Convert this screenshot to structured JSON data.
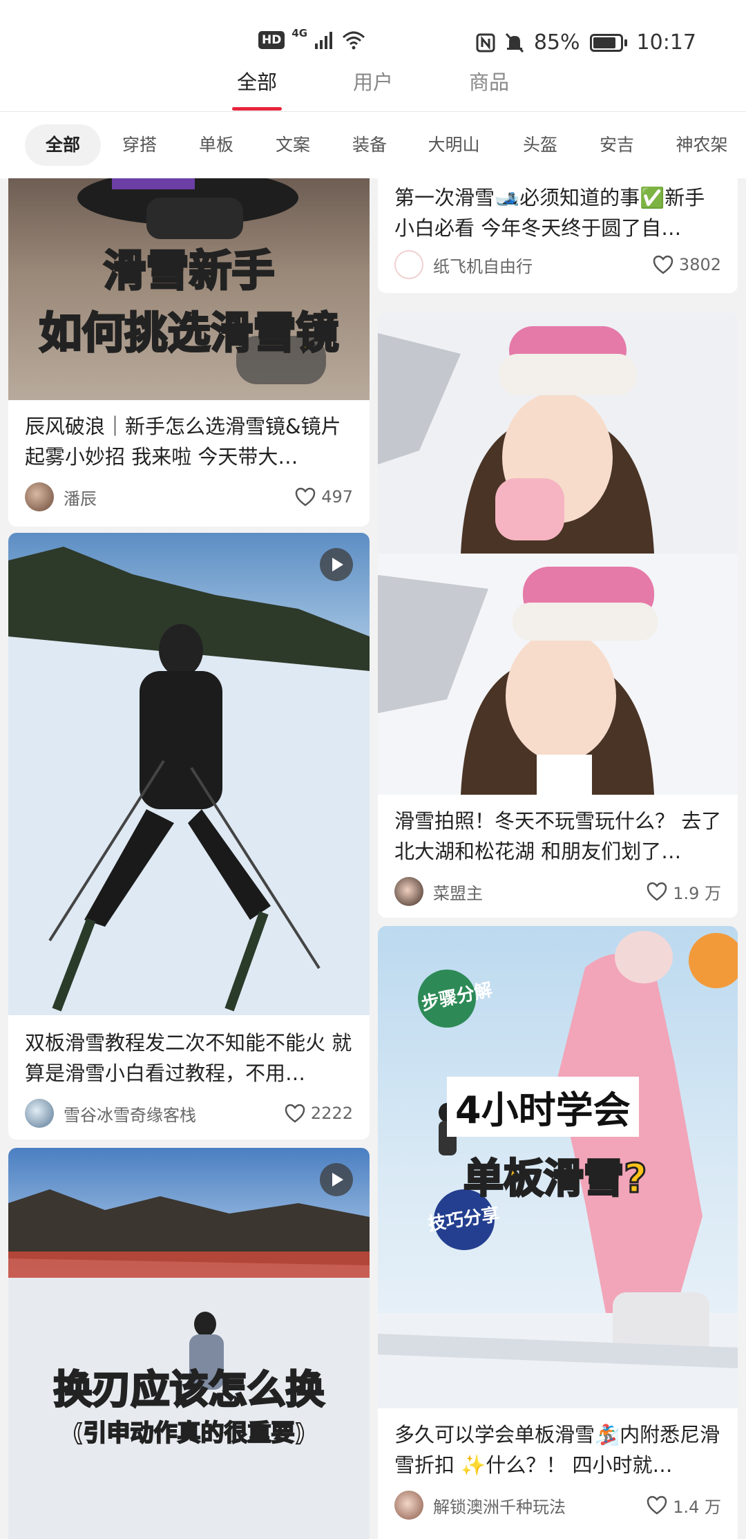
{
  "status": {
    "hd": "HD",
    "net": "4G",
    "battery": "85%",
    "battery_level": 0.85,
    "time": "10:17"
  },
  "top_tabs": [
    "全部",
    "用户",
    "商品"
  ],
  "chips": [
    "全部",
    "穿搭",
    "单板",
    "文案",
    "装备",
    "大明山",
    "头盔",
    "安吉",
    "神农架"
  ],
  "cards": {
    "goggles": {
      "overlay_1": "滑雪新手",
      "overlay_2": "如何挑选滑雪镜",
      "title": "辰风破浪｜新手怎么选滑雪镜&镜片起雾小妙招 我来啦 今天带大…",
      "author": "潘辰",
      "likes": "497"
    },
    "first_ski": {
      "title": "第一次滑雪🎿必须知道的事✅新手小白必看 今年冬天终于圆了自…",
      "author": "纸飞机自由行",
      "likes": "3802"
    },
    "photo": {
      "title": "滑雪拍照！冬天不玩雪玩什么？ 去了北大湖和松花湖 和朋友们划了…",
      "author": "菜盟主",
      "likes": "1.9 万"
    },
    "double_board": {
      "title": "双板滑雪教程发二次不知能不能火 就算是滑雪小白看过教程，不用…",
      "author": "雪谷冰雪奇缘客栈",
      "likes": "2222"
    },
    "snowboard": {
      "tag_1": "步骤分解",
      "overlay_1": "4小时学会",
      "overlay_2": "单板滑雪?",
      "tag_2": "技巧分享",
      "title": "多久可以学会单板滑雪🏂内附悉尼滑雪折扣 ✨什么？！ 四小时就…",
      "author": "解锁澳洲千种玩法",
      "likes": "1.4 万"
    },
    "edge": {
      "overlay_1": "换刃应该怎么换",
      "overlay_2": "(引申动作真的很重要)"
    }
  },
  "colors": {
    "accent": "#e8253d",
    "overlay_yellow": "#ffd400"
  }
}
